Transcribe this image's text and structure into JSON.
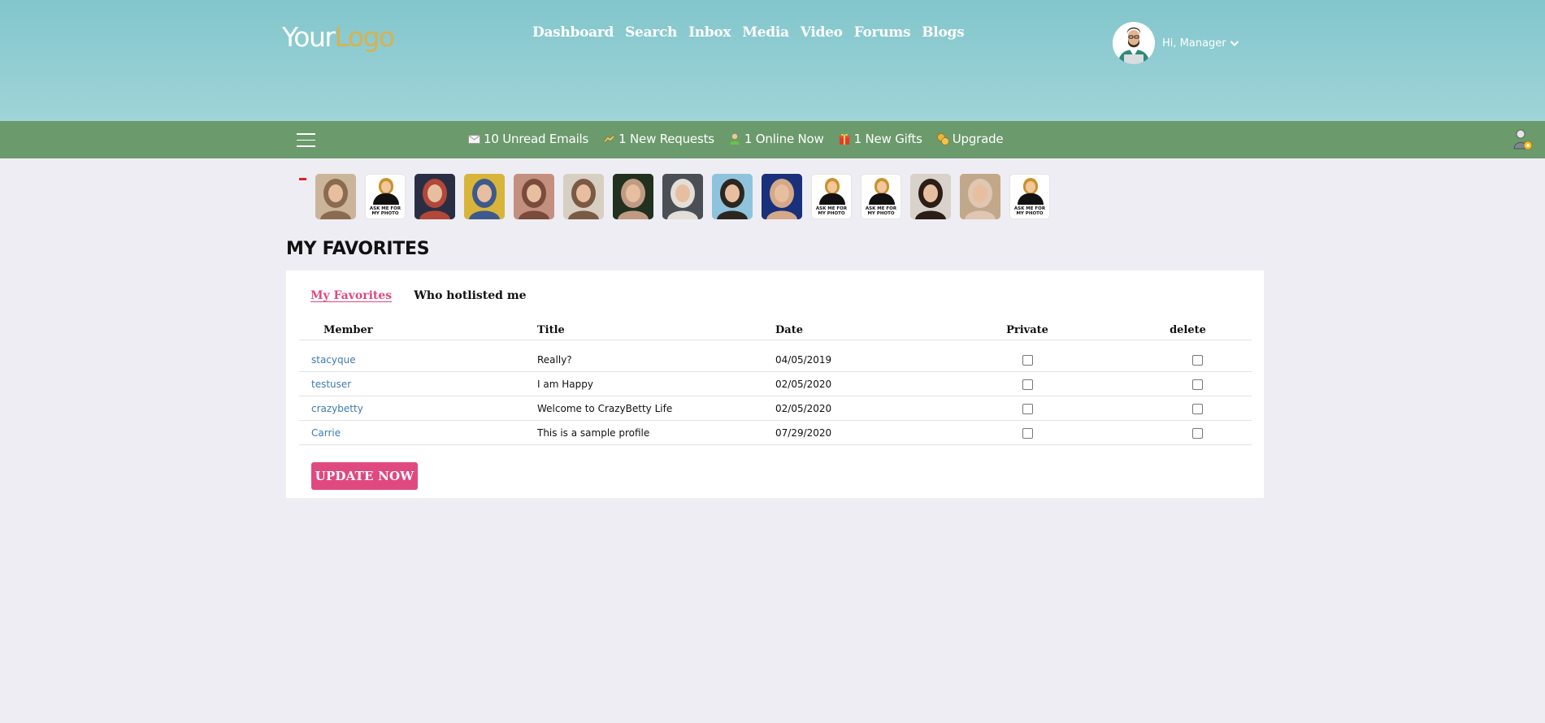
{
  "header": {
    "logo": {
      "part1": "Your",
      "part2": "Logo"
    },
    "nav": [
      "Dashboard",
      "Search",
      "Inbox",
      "Media",
      "Video",
      "Forums",
      "Blogs"
    ],
    "user": {
      "greeting": "Hi, Manager",
      "icon": "chevron-down-icon"
    }
  },
  "statsbar": {
    "items": [
      {
        "icon": "envelope-icon",
        "label": "10 Unread Emails"
      },
      {
        "icon": "handshake-icon",
        "label": "1 New Requests"
      },
      {
        "icon": "person-online-icon",
        "label": "1 Online Now"
      },
      {
        "icon": "gift-icon",
        "label": "1 New Gifts"
      },
      {
        "icon": "coins-icon",
        "label": "Upgrade"
      }
    ]
  },
  "thumbnails": {
    "ask_text": "ASK ME FOR MY PHOTO",
    "items": [
      {
        "type": "photo",
        "colors": [
          "#cbb59a",
          "#8b6b50"
        ]
      },
      {
        "type": "ask"
      },
      {
        "type": "photo",
        "colors": [
          "#2a2e45",
          "#b3473a"
        ]
      },
      {
        "type": "photo",
        "colors": [
          "#d8b53a",
          "#3e5a8c"
        ]
      },
      {
        "type": "photo",
        "colors": [
          "#c39080",
          "#7a4a3a"
        ]
      },
      {
        "type": "photo",
        "colors": [
          "#d7cfc2",
          "#7a5a44"
        ]
      },
      {
        "type": "photo",
        "colors": [
          "#22301f",
          "#c09b83"
        ]
      },
      {
        "type": "photo",
        "colors": [
          "#4a4e55",
          "#e3ded8"
        ]
      },
      {
        "type": "photo",
        "colors": [
          "#8fc3dd",
          "#2c2620"
        ]
      },
      {
        "type": "photo",
        "colors": [
          "#19307a",
          "#d3a98a"
        ]
      },
      {
        "type": "ask"
      },
      {
        "type": "ask"
      },
      {
        "type": "photo",
        "colors": [
          "#d8d2ca",
          "#2c1d17"
        ]
      },
      {
        "type": "photo",
        "colors": [
          "#c2a88a",
          "#e0c7b3"
        ]
      },
      {
        "type": "ask"
      }
    ]
  },
  "page": {
    "title": "MY FAVORITES"
  },
  "tabs": [
    {
      "label": "My Favorites",
      "active": true
    },
    {
      "label": "Who hotlisted me",
      "active": false
    }
  ],
  "table": {
    "headers": [
      "Member",
      "Title",
      "Date",
      "Private",
      "delete"
    ],
    "rows": [
      {
        "member": "stacyque",
        "title": "Really?",
        "date": "04/05/2019"
      },
      {
        "member": "testuser",
        "title": "I am Happy",
        "date": "02/05/2020"
      },
      {
        "member": "crazybetty",
        "title": "Welcome to CrazyBetty Life",
        "date": "02/05/2020"
      },
      {
        "member": "Carrie",
        "title": "This is a sample profile",
        "date": "07/29/2020"
      }
    ]
  },
  "actions": {
    "update_label": "UPDATE NOW"
  },
  "colors": {
    "header_top": "#82c6cc",
    "statsbar": "#6b9a6c",
    "accent": "#e0497f",
    "link": "#3d7bb0",
    "logo_accent": "#d7b24f"
  }
}
